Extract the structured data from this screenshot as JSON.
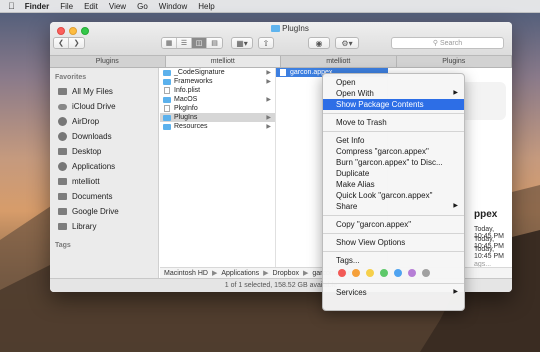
{
  "menubar": {
    "apple": "",
    "app": "Finder",
    "items": [
      "File",
      "Edit",
      "View",
      "Go",
      "Window",
      "Help"
    ]
  },
  "window": {
    "title": "PlugIns",
    "search_placeholder": "Search",
    "tabs": [
      "Plugins",
      "mtelliott",
      "mtelliott",
      "Plugins"
    ]
  },
  "sidebar": {
    "favorites_label": "Favorites",
    "items": [
      {
        "label": "All My Files",
        "icon": "all-files-icon"
      },
      {
        "label": "iCloud Drive",
        "icon": "cloud-icon"
      },
      {
        "label": "AirDrop",
        "icon": "airdrop-icon"
      },
      {
        "label": "Downloads",
        "icon": "downloads-icon"
      },
      {
        "label": "Desktop",
        "icon": "desktop-icon"
      },
      {
        "label": "Applications",
        "icon": "applications-icon"
      },
      {
        "label": "mtelliott",
        "icon": "home-icon"
      },
      {
        "label": "Documents",
        "icon": "documents-icon"
      },
      {
        "label": "Google Drive",
        "icon": "folder-icon"
      },
      {
        "label": "Library",
        "icon": "folder-icon"
      }
    ],
    "tags_label": "Tags"
  },
  "column1": [
    {
      "name": "_CodeSignature",
      "type": "folder"
    },
    {
      "name": "Frameworks",
      "type": "folder"
    },
    {
      "name": "Info.plist",
      "type": "file"
    },
    {
      "name": "MacOS",
      "type": "folder"
    },
    {
      "name": "PkgInfo",
      "type": "file"
    },
    {
      "name": "PlugIns",
      "type": "folder",
      "selected": true
    },
    {
      "name": "Resources",
      "type": "folder"
    }
  ],
  "column2": [
    {
      "name": "garcon.appex",
      "selected": true
    }
  ],
  "preview": {
    "name": "ppex",
    "lines": [
      "Today, 10:45 PM",
      "Today, 10:45 PM",
      "Today, 10:45 PM",
      "ags..."
    ]
  },
  "pathbar": [
    "Macintosh HD",
    "Applications",
    "Dropbox",
    "garcon.appex"
  ],
  "status": "1 of 1 selected, 158.52 GB available",
  "context_menu": {
    "group1": [
      {
        "label": "Open",
        "sub": false
      },
      {
        "label": "Open With",
        "sub": true
      },
      {
        "label": "Show Package Contents",
        "sub": false,
        "highlight": true
      }
    ],
    "group2": [
      {
        "label": "Move to Trash",
        "sub": false
      }
    ],
    "group3": [
      {
        "label": "Get Info",
        "sub": false
      },
      {
        "label": "Compress \"garcon.appex\"",
        "sub": false
      },
      {
        "label": "Burn \"garcon.appex\" to Disc...",
        "sub": false
      },
      {
        "label": "Duplicate",
        "sub": false
      },
      {
        "label": "Make Alias",
        "sub": false
      },
      {
        "label": "Quick Look \"garcon.appex\"",
        "sub": false
      },
      {
        "label": "Share",
        "sub": true
      }
    ],
    "group4": [
      {
        "label": "Copy \"garcon.appex\"",
        "sub": false
      }
    ],
    "group5": [
      {
        "label": "Show View Options",
        "sub": false
      }
    ],
    "group6": [
      {
        "label": "Tags...",
        "sub": false
      }
    ],
    "tag_colors": [
      "#f25a56",
      "#f5a03a",
      "#f6d04b",
      "#5dc869",
      "#4fa3f0",
      "#b67ed6",
      "#a0a0a0"
    ],
    "group7": [
      {
        "label": "Services",
        "sub": true
      }
    ]
  }
}
